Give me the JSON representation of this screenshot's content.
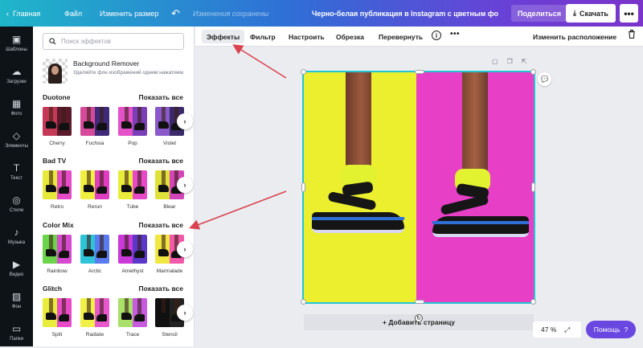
{
  "topbar": {
    "home": "Главная",
    "file": "Файл",
    "resize": "Изменить размер",
    "doc_placeholder": "Изменения сохранены",
    "title": "Черно-белая публикация в Instagram с цветным фото де...",
    "share": "Поделиться",
    "download": "Скачать",
    "more": "•••"
  },
  "leftnav": [
    {
      "label": "Шаблоны",
      "icon": "templates-icon",
      "glyph": "▣"
    },
    {
      "label": "Загрузки",
      "icon": "upload-icon",
      "glyph": "☁"
    },
    {
      "label": "Фото",
      "icon": "photo-icon",
      "glyph": "▦"
    },
    {
      "label": "Элементы",
      "icon": "elements-icon",
      "glyph": "◇"
    },
    {
      "label": "Текст",
      "icon": "text-icon",
      "glyph": "T"
    },
    {
      "label": "Стили",
      "icon": "styles-icon",
      "glyph": "◎"
    },
    {
      "label": "Музыка",
      "icon": "music-icon",
      "glyph": "♪"
    },
    {
      "label": "Видео",
      "icon": "video-icon",
      "glyph": "▶"
    },
    {
      "label": "Фон",
      "icon": "background-icon",
      "glyph": "▨"
    },
    {
      "label": "Папки",
      "icon": "folder-icon",
      "glyph": "▭"
    }
  ],
  "panel": {
    "search_placeholder": "Поиск эффектов",
    "bg_remover": {
      "title": "Background Remover",
      "desc": "Удаляйте фон изображений одним нажатием."
    },
    "sections": [
      {
        "title": "Duotone",
        "show_all": "Показать все",
        "items": [
          {
            "label": "Cherry",
            "colors": [
              "#c43a56",
              "#5a1a2c"
            ]
          },
          {
            "label": "Fuchsia",
            "colors": [
              "#d64a9c",
              "#3f2a7a"
            ]
          },
          {
            "label": "Pop",
            "colors": [
              "#e452c8",
              "#7a3fb8"
            ]
          },
          {
            "label": "Violet",
            "colors": [
              "#8a5acb",
              "#3b2a6a"
            ]
          }
        ]
      },
      {
        "title": "Bad TV",
        "show_all": "Показать все",
        "items": [
          {
            "label": "Retro",
            "colors": [
              "#e6e83a",
              "#e64ac6"
            ]
          },
          {
            "label": "Rerun",
            "colors": [
              "#f0f040",
              "#e03cc0"
            ]
          },
          {
            "label": "Tube",
            "colors": [
              "#e8ec3a",
              "#e849c8"
            ]
          },
          {
            "label": "Blear",
            "colors": [
              "#dfe238",
              "#d445b8"
            ]
          }
        ]
      },
      {
        "title": "Color Mix",
        "show_all": "Показать все",
        "items": [
          {
            "label": "Rainbow",
            "colors": [
              "#6bd44a",
              "#d64ad0"
            ]
          },
          {
            "label": "Arctic",
            "colors": [
              "#2ec4d8",
              "#5a7af0"
            ]
          },
          {
            "label": "Amethyst",
            "colors": [
              "#c93ad8",
              "#5a38c8"
            ]
          },
          {
            "label": "Marmalade",
            "colors": [
              "#f0e840",
              "#f05aa8"
            ]
          }
        ]
      },
      {
        "title": "Glitch",
        "show_all": "Показать все",
        "items": [
          {
            "label": "Split",
            "colors": [
              "#e8ec3a",
              "#e84ac8"
            ]
          },
          {
            "label": "Radiate",
            "colors": [
              "#f0f048",
              "#e858cc"
            ]
          },
          {
            "label": "Trace",
            "colors": [
              "#a8e06a",
              "#c85ae0"
            ]
          },
          {
            "label": "Stencil",
            "colors": [
              "#111111",
              "#222222"
            ]
          }
        ]
      }
    ]
  },
  "toolbar": {
    "effects": "Эффекты",
    "filter": "Фильтр",
    "adjust": "Настроить",
    "crop": "Обрезка",
    "flip": "Перевернуть",
    "info": "i",
    "more": "•••",
    "arrange": "Изменить расположение"
  },
  "canvas": {
    "add_page": "+ Добавить страницу",
    "zoom": "47 %",
    "help": "Помощь",
    "help_icon": "?"
  },
  "colors": {
    "accent": "#6a47e0",
    "selection": "#22c5d3",
    "annotation_arrow": "#d9434f",
    "yellow": "#ecef2e",
    "pink": "#e83fc7"
  }
}
